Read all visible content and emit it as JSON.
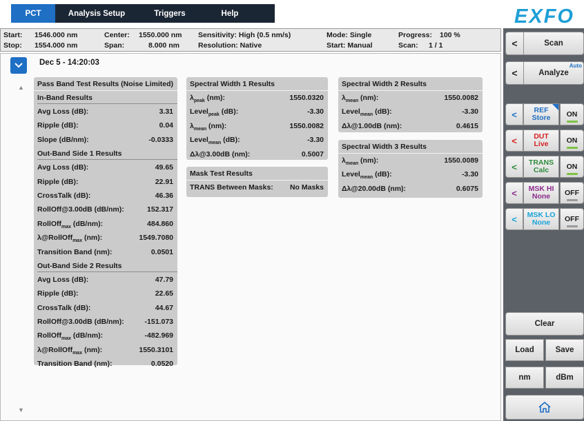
{
  "tabs": [
    {
      "label": "PCT",
      "active": true
    },
    {
      "label": "Analysis Setup",
      "active": false
    },
    {
      "label": "Triggers",
      "active": false
    },
    {
      "label": "Help",
      "active": false
    }
  ],
  "logo": "EXFO",
  "info": {
    "start_label": "Start:",
    "start_value": "1546.000 nm",
    "stop_label": "Stop:",
    "stop_value": "1554.000 nm",
    "center_label": "Center:",
    "center_value": "1550.000 nm",
    "span_label": "Span:",
    "span_value": "8.000 nm",
    "sensitivity": "Sensitivity: High (0.5 nm/s)",
    "resolution": "Resolution: Native",
    "mode": "Mode: Single",
    "start_mode": "Start: Manual",
    "progress_label": "Progress:",
    "progress_value": "100 %",
    "scan_label": "Scan:",
    "scan_value": "1 / 1"
  },
  "datetime": "Dec 5 - 14:20:03",
  "passband": {
    "title": "Pass Band Test Results (Noise Limited)",
    "inband_title": "In-Band Results",
    "inband": [
      {
        "label": "Avg Loss (dB):",
        "value": "3.31"
      },
      {
        "label": "Ripple (dB):",
        "value": "0.04"
      },
      {
        "label": "Slope (dB/nm):",
        "value": "-0.0333"
      }
    ],
    "out1_title": "Out-Band Side 1 Results",
    "out1": [
      {
        "label": "Avg Loss (dB):",
        "value": "49.65"
      },
      {
        "label": "Ripple (dB):",
        "value": "22.91"
      },
      {
        "label": "CrossTalk (dB):",
        "value": "46.36"
      },
      {
        "label": "RollOff@3.00dB (dB/nm):",
        "value": "152.317"
      },
      {
        "label": "RollOff",
        "sub": "max",
        "suffix": " (dB/nm):",
        "value": "484.860"
      },
      {
        "label": "λ@RollOff",
        "sub": "max",
        "suffix": " (nm):",
        "value": "1549.7080"
      },
      {
        "label": "Transition Band (nm):",
        "value": "0.0501"
      }
    ],
    "out2_title": "Out-Band Side 2 Results",
    "out2": [
      {
        "label": "Avg Loss (dB):",
        "value": "47.79"
      },
      {
        "label": "Ripple (dB):",
        "value": "22.65"
      },
      {
        "label": "CrossTalk (dB):",
        "value": "44.67"
      },
      {
        "label": "RollOff@3.00dB (dB/nm):",
        "value": "-151.073"
      },
      {
        "label": "RollOff",
        "sub": "max",
        "suffix": " (dB/nm):",
        "value": "-482.969"
      },
      {
        "label": "λ@RollOff",
        "sub": "max",
        "suffix": " (nm):",
        "value": "1550.3101"
      },
      {
        "label": "Transition Band (nm):",
        "value": "0.0520"
      }
    ]
  },
  "sw1": {
    "title": "Spectral Width 1 Results",
    "rows": [
      {
        "label": "λ",
        "sub": "peak",
        "suffix": " (nm):",
        "value": "1550.0320"
      },
      {
        "label": "Level",
        "sub": "peak",
        "suffix": " (dB):",
        "value": "-3.30"
      },
      {
        "label": "λ",
        "sub": "mean",
        "suffix": " (nm):",
        "value": "1550.0082"
      },
      {
        "label": "Level",
        "sub": "mean",
        "suffix": " (dB):",
        "value": "-3.30"
      },
      {
        "label": "Δλ@3.00dB (nm):",
        "value": "0.5007"
      }
    ]
  },
  "mask": {
    "title": "Mask Test Results",
    "rows": [
      {
        "label": "TRANS Between Masks:",
        "value": "No Masks"
      }
    ]
  },
  "sw2": {
    "title": "Spectral Width 2 Results",
    "rows": [
      {
        "label": "λ",
        "sub": "mean",
        "suffix": " (nm):",
        "value": "1550.0082"
      },
      {
        "label": "Level",
        "sub": "mean",
        "suffix": " (dB):",
        "value": "-3.30"
      },
      {
        "label": "Δλ@1.00dB (nm):",
        "value": "0.4615"
      }
    ]
  },
  "sw3": {
    "title": "Spectral Width 3 Results",
    "rows": [
      {
        "label": "λ",
        "sub": "mean",
        "suffix": " (nm):",
        "value": "1550.0089"
      },
      {
        "label": "Level",
        "sub": "mean",
        "suffix": " (dB):",
        "value": "-3.30"
      },
      {
        "label": "Δλ@20.00dB (nm):",
        "value": "0.6075"
      }
    ]
  },
  "side": {
    "scan": "Scan",
    "analyze": "Analyze",
    "auto": "Auto",
    "traces": [
      {
        "name1": "REF",
        "name2": "Store",
        "state": "ON",
        "color": "#1f6fc4",
        "ind": "#7dc242",
        "corner": true
      },
      {
        "name1": "DUT",
        "name2": "Live",
        "state": "ON",
        "color": "#d62020",
        "ind": "#7dc242",
        "corner": false
      },
      {
        "name1": "TRANS",
        "name2": "Calc",
        "state": "ON",
        "color": "#2e8b3a",
        "ind": "#7dc242",
        "corner": false
      },
      {
        "name1": "MSK HI",
        "name2": "None",
        "state": "OFF",
        "color": "#8b2b8b",
        "ind": "#9a9a9a",
        "corner": false
      },
      {
        "name1": "MSK LO",
        "name2": "None",
        "state": "OFF",
        "color": "#1aa3d9",
        "ind": "#9a9a9a",
        "corner": false
      }
    ],
    "clear": "Clear",
    "load": "Load",
    "save": "Save",
    "nm": "nm",
    "dbm": "dBm",
    "home_icon": "home-icon"
  }
}
